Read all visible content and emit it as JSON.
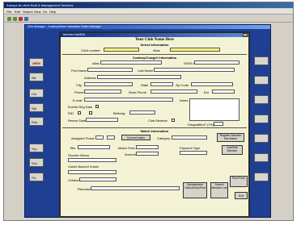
{
  "browser": {
    "title": "Kaseya Nu Web Built & Management Services",
    "menu": [
      "File",
      "Edit",
      "Search",
      "View",
      "Go",
      "Help"
    ]
  },
  "app": {
    "title": "Club Manager - CowboyOnline Interactive Online Manager",
    "side_left": [
      "MEM",
      "Sle",
      "Clo",
      "Rpt",
      "Rnk",
      "Grp",
      "Sch",
      "Fin"
    ],
    "side_right": [
      "",
      "",
      "",
      "",
      "",
      "",
      ""
    ]
  },
  "dialog": {
    "title": "Member  Add/Edit",
    "close": "x",
    "club_name": "Your Club Name Here",
    "section_select": "Select Information",
    "cla_number_label": "CA/A number",
    "alias_label": "Alias",
    "section_cowboy": "Cowboy/Cowgirl Information",
    "alias2_label": "Alias",
    "sass_label": "SASS #",
    "first_name_label": "First Name",
    "last_name_label": "Last Name",
    "address_label": "Address",
    "city_label": "City",
    "state_label": "State",
    "zip_label": "Zip Code",
    "phone_label": "Phone",
    "work_phone_label": "Work Phone",
    "ext_label": "Ext",
    "email_label": "E-mail",
    "notes_label": "Notes",
    "events_label": "Events Reg Date",
    "rid_label": "RID",
    "birthday_label": "Birthday",
    "renew_date_label": "Renew Date",
    "club_member_label": "Club Member",
    "disqualified_label": "Disqualified? (Y/N)",
    "section_match": "Match Information",
    "assigned_posse_label": "Assigned Posse",
    "current_match_btn": "Current match",
    "category_label": "Category",
    "register_btn": "Register Member this Match",
    "title_label": "Title",
    "match_fees_label": "Match Fees",
    "amount_label": "Amount",
    "payment_type_label": "Payment Type",
    "add_edit_btn": "Add/Edit Member",
    "shooter_memo_label": "Shooter Memo",
    "guests_label": "Guest's Name/of Guests",
    "children_label": "Children",
    "remarks_label": "Remarks",
    "print_form_btn": "Print Form",
    "spreadsheet_btn": "Spreadsheet Class/Entry/Post",
    "search_btn": "Search Member List",
    "exit_btn": "Exit"
  }
}
